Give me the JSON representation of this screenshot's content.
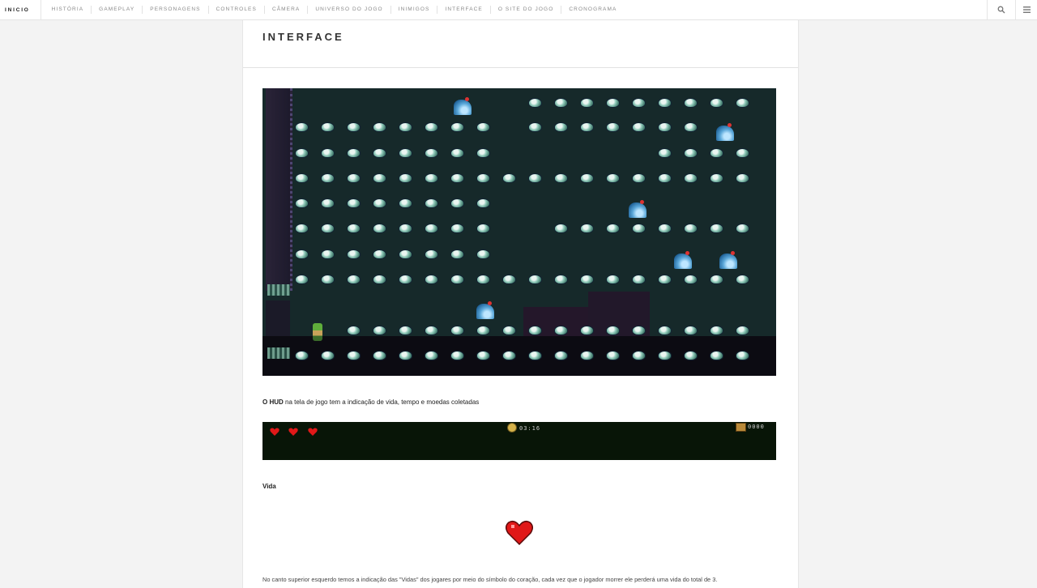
{
  "nav": {
    "brand": "INICIO",
    "items": [
      "HISTÓRIA",
      "GAMEPLAY",
      "PERSONAGENS",
      "CONTROLES",
      "CÂMERA",
      "UNIVERSO DO JOGO",
      "INIMIGOS",
      "INTERFACE",
      "O SITE DO JOGO",
      "CRONOGRAMA"
    ],
    "search_icon": "search-icon",
    "menu_icon": "menu-icon"
  },
  "page": {
    "title": "INTERFACE"
  },
  "content": {
    "caption_bold": "O HUD",
    "caption_rest": " na tela de jogo tem a indicação de vida, tempo e moedas coletadas",
    "hud": {
      "time": "03:16",
      "count": "0000",
      "lives": 3
    },
    "section_label": "Vida",
    "paragraph": "No canto superior esquerdo temos a indicação das \"Vidas\" dos jogares por meio do símbolo do coração, cada vez que o jogador morrer ele perderá uma vida do total de 3."
  },
  "colors": {
    "heart": "#e01818",
    "game_bg": "#16292a",
    "hud_bg": "#081507"
  }
}
